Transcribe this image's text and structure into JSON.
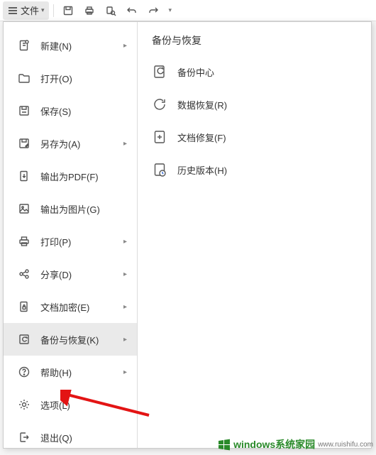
{
  "toolbar": {
    "file_label": "文件"
  },
  "menu": {
    "items": [
      {
        "label": "新建(N)",
        "has_arrow": true
      },
      {
        "label": "打开(O)",
        "has_arrow": false
      },
      {
        "label": "保存(S)",
        "has_arrow": false
      },
      {
        "label": "另存为(A)",
        "has_arrow": true
      },
      {
        "label": "输出为PDF(F)",
        "has_arrow": false
      },
      {
        "label": "输出为图片(G)",
        "has_arrow": false
      },
      {
        "label": "打印(P)",
        "has_arrow": true
      },
      {
        "label": "分享(D)",
        "has_arrow": true
      },
      {
        "label": "文档加密(E)",
        "has_arrow": true
      },
      {
        "label": "备份与恢复(K)",
        "has_arrow": true
      },
      {
        "label": "帮助(H)",
        "has_arrow": true
      },
      {
        "label": "选项(L)",
        "has_arrow": false
      },
      {
        "label": "退出(Q)",
        "has_arrow": false
      }
    ]
  },
  "panel": {
    "title": "备份与恢复",
    "items": [
      {
        "label": "备份中心"
      },
      {
        "label": "数据恢复(R)"
      },
      {
        "label": "文档修复(F)"
      },
      {
        "label": "历史版本(H)"
      }
    ]
  },
  "watermark": {
    "text": "windows系统家园",
    "sub": "www.ruishifu.com"
  },
  "colors": {
    "annotation_red": "#e31414",
    "watermark_green": "#2a8a2a"
  }
}
